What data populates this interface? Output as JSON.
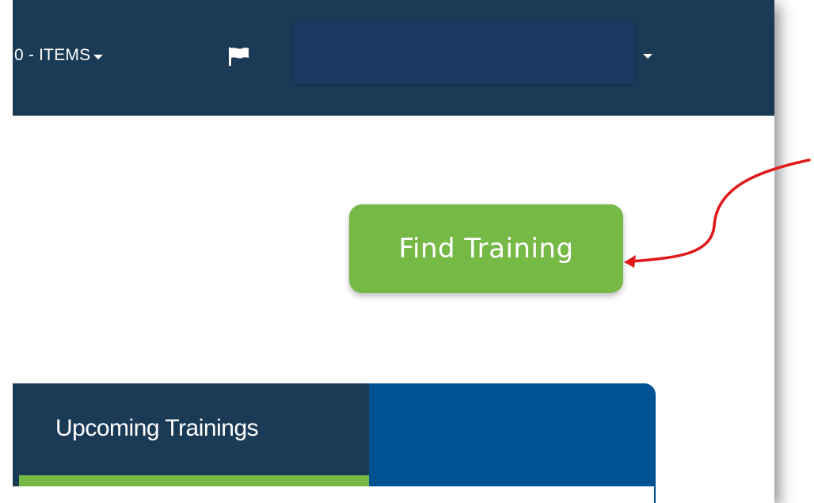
{
  "header": {
    "items_menu_label": "0 - ITEMS",
    "background_color": "#1b3a56",
    "user_dropdown_color": "#1a3a63"
  },
  "icons": {
    "flag": "flag-icon",
    "items_caret": "caret-down-icon",
    "user_caret": "caret-down-icon"
  },
  "main": {
    "find_training_label": "Find Training",
    "button_color": "#76b947"
  },
  "tabs": [
    {
      "label": "Upcoming Trainings",
      "active": true
    }
  ],
  "annotation": {
    "arrow_color": "#e0191b"
  }
}
